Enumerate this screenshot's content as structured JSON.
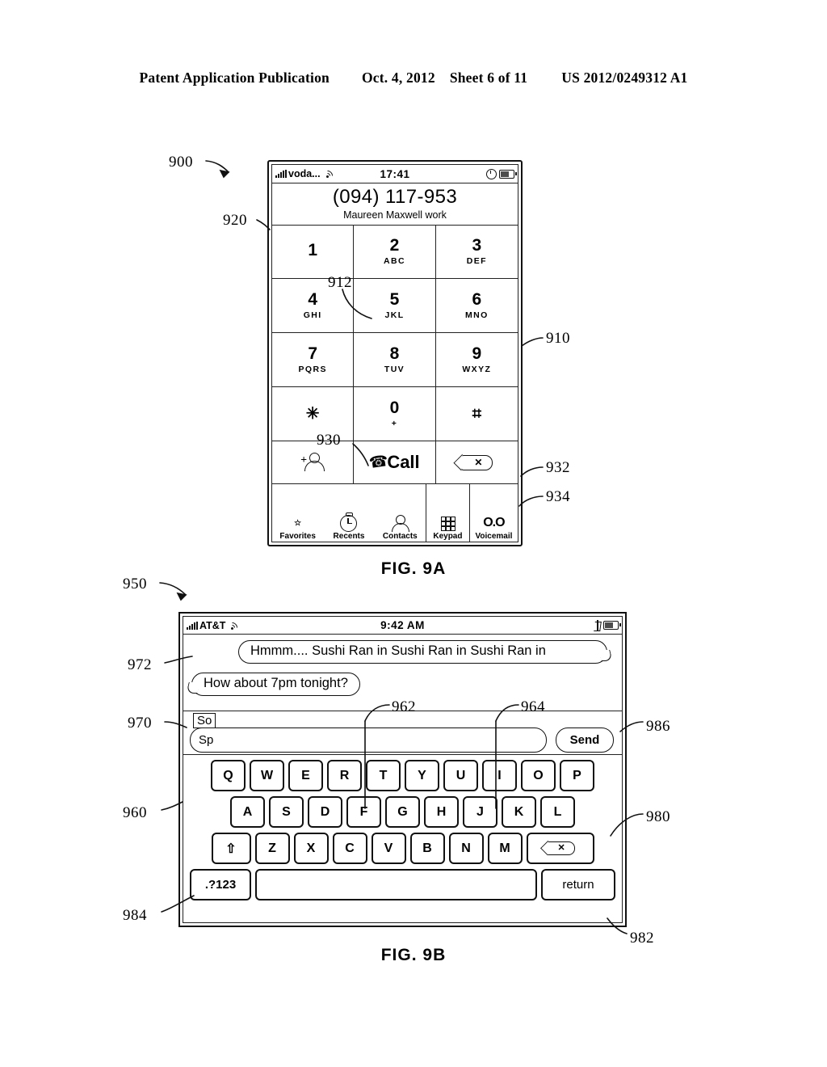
{
  "header": {
    "publication": "Patent Application Publication",
    "date": "Oct. 4, 2012",
    "sheet": "Sheet 6 of 11",
    "number": "US 2012/0249312 A1"
  },
  "fig9a": {
    "caption": "FIG. 9A",
    "refs": {
      "device": "900",
      "display": "920",
      "keypad": "910",
      "key5": "912",
      "star_key": "930",
      "call_button": "932",
      "tab_bar": "934"
    },
    "status_bar": {
      "carrier": "voda...",
      "time": "17:41",
      "signal_icon": "signal-bars-icon",
      "wifi_icon": "wifi-icon",
      "alarm_icon": "clock-icon",
      "battery_icon": "battery-icon"
    },
    "number_display": {
      "number": "(094) 117-953",
      "contact": "Maureen Maxwell work"
    },
    "keys": [
      {
        "digit": "1",
        "letters": ""
      },
      {
        "digit": "2",
        "letters": "ABC"
      },
      {
        "digit": "3",
        "letters": "DEF"
      },
      {
        "digit": "4",
        "letters": "GHI"
      },
      {
        "digit": "5",
        "letters": "JKL"
      },
      {
        "digit": "6",
        "letters": "MNO"
      },
      {
        "digit": "7",
        "letters": "PQRS"
      },
      {
        "digit": "8",
        "letters": "TUV"
      },
      {
        "digit": "9",
        "letters": "WXYZ"
      },
      {
        "digit": "✳",
        "letters": ""
      },
      {
        "digit": "0",
        "letters": "+"
      },
      {
        "digit": "⌗",
        "letters": ""
      }
    ],
    "actions": {
      "add_contact_icon": "add-contact-icon",
      "call_label": "Call",
      "call_icon": "phone-handset-icon",
      "delete_icon": "backspace-icon"
    },
    "tabs": [
      {
        "label": "Favorites",
        "icon": "star-icon"
      },
      {
        "label": "Recents",
        "icon": "clock-icon"
      },
      {
        "label": "Contacts",
        "icon": "person-icon"
      },
      {
        "label": "Keypad",
        "icon": "keypad-grid-icon"
      },
      {
        "label": "Voicemail",
        "icon": "voicemail-icon"
      }
    ]
  },
  "fig9b": {
    "caption": "FIG. 9B",
    "refs": {
      "device": "950",
      "text_entry_area": "970",
      "message_area": "972",
      "keyboard": "960",
      "key_f": "962",
      "key_j": "964",
      "backspace_key": "980",
      "space_key": "982",
      "num_key": "984",
      "send_button": "986"
    },
    "status_bar": {
      "carrier": "AT&T",
      "time": "9:42 AM",
      "signal_icon": "signal-bars-icon",
      "wifi_icon": "wifi-icon",
      "bluetooth_icon": "bluetooth-icon",
      "battery_icon": "battery-icon"
    },
    "messages": [
      {
        "text": "Hmmm.... Sushi Ran in Sushi Ran in Sushi Ran in",
        "side": "incoming"
      },
      {
        "text": "How about 7pm tonight?",
        "side": "outgoing"
      }
    ],
    "input": {
      "suggestion": "So",
      "typed_text": "Sp",
      "send_label": "Send"
    },
    "keyboard": {
      "row1": [
        "Q",
        "W",
        "E",
        "R",
        "T",
        "Y",
        "U",
        "I",
        "O",
        "P"
      ],
      "row2": [
        "A",
        "S",
        "D",
        "F",
        "G",
        "H",
        "J",
        "K",
        "L"
      ],
      "row3": [
        "Z",
        "X",
        "C",
        "V",
        "B",
        "N",
        "M"
      ],
      "shift_label": "⇧",
      "backspace_icon": "backspace-icon",
      "num_label": ".?123",
      "space_label": "",
      "return_label": "return"
    }
  }
}
